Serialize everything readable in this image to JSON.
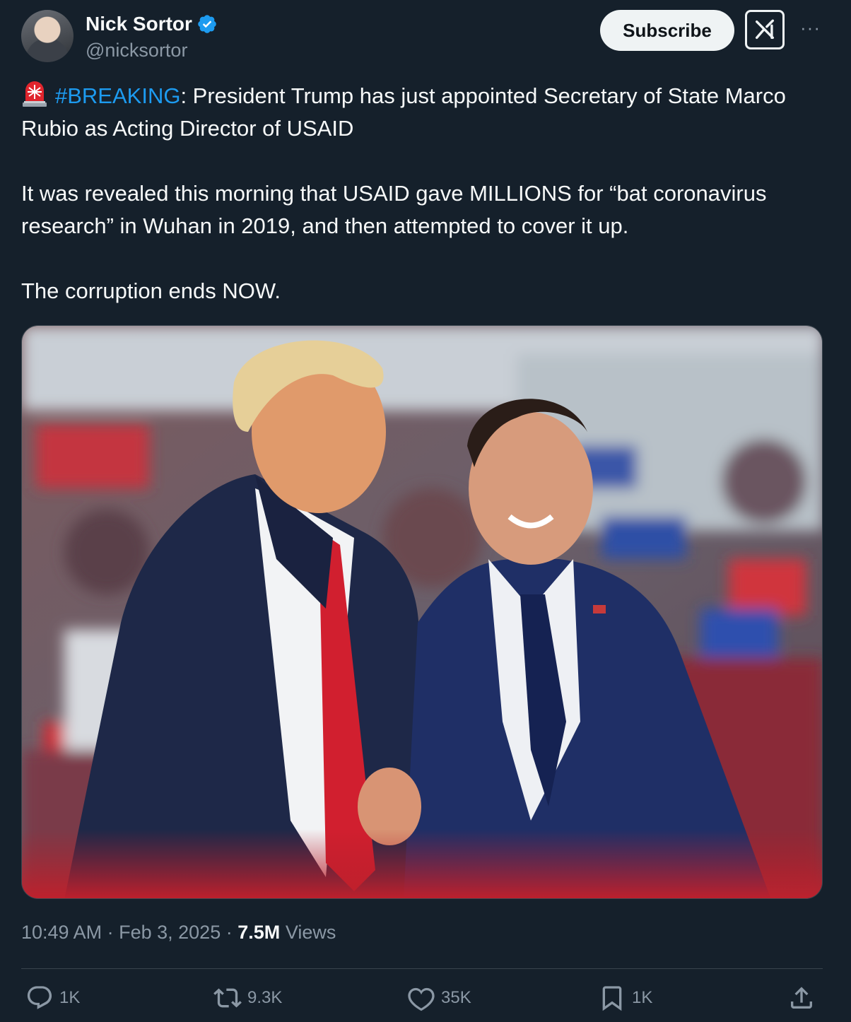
{
  "author": {
    "name": "Nick Sortor",
    "handle": "@nicksortor"
  },
  "header": {
    "subscribe_label": "Subscribe",
    "grok_icon": "grok-icon",
    "more_label": "···"
  },
  "tweet": {
    "hashtag": "#BREAKING",
    "line1_rest": ": President Trump has just appointed Secretary of State Marco Rubio as Acting Director of USAID",
    "paragraph2": "It was revealed this morning that USAID gave MILLIONS for “bat coronavirus research” in Wuhan in 2019, and then attempted to cover it up.",
    "paragraph3": "The corruption ends NOW."
  },
  "meta": {
    "time": "10:49 AM",
    "separator": "·",
    "date": "Feb 3, 2025",
    "views_count": "7.5M",
    "views_label": "Views"
  },
  "actions": {
    "replies": "1K",
    "reposts": "9.3K",
    "likes": "35K",
    "bookmarks": "1K"
  },
  "colors": {
    "background": "#15202b",
    "link": "#1d9bf0",
    "muted": "#8b98a5",
    "verified": "#1d9bf0"
  }
}
